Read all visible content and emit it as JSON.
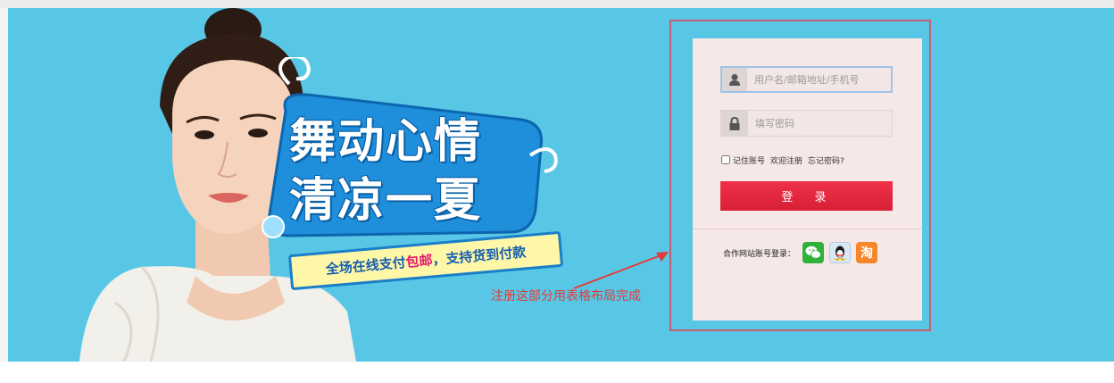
{
  "promo": {
    "title_line1": "舞动心情",
    "title_line2": "清凉一夏",
    "ribbon_prefix": "全场在线支付",
    "ribbon_highlight": "包邮",
    "ribbon_suffix": "，支持货到付款"
  },
  "annotation": {
    "text": "注册这部分用表格布局完成"
  },
  "login": {
    "username_placeholder": "用户名/邮箱地址/手机号",
    "password_placeholder": "填写密码",
    "remember_label": "记住账号",
    "register_link": "欢迎注册",
    "forgot_link": "忘记密码?",
    "submit_label": "登 录",
    "partner_label": "合作网站账号登录：",
    "taobao_glyph": "淘",
    "icons": [
      "user-icon",
      "lock-icon",
      "wechat-icon",
      "qq-icon",
      "taobao-icon"
    ]
  },
  "colors": {
    "banner_bg": "#58c7e6",
    "login_button": "#e3263e",
    "annotation_red": "#e53935",
    "panel_bg": "#f7e8e8"
  }
}
